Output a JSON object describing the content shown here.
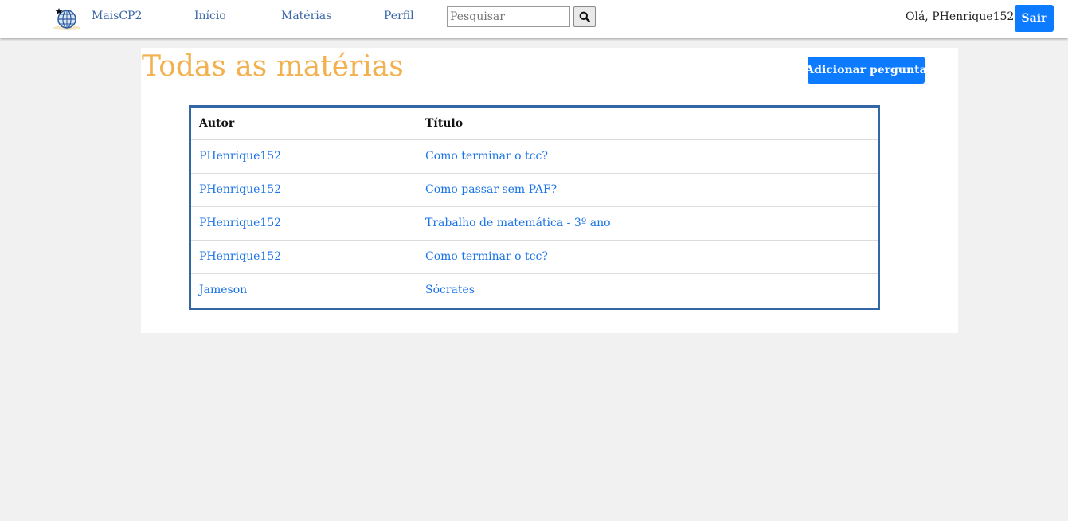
{
  "nav": {
    "brand": "MaisCP2",
    "links": [
      "Início",
      "Matérias",
      "Perfil"
    ],
    "search_placeholder": "Pesquisar",
    "greeting": "Olá, PHenrique152",
    "logout_label": "Sair"
  },
  "main": {
    "title": "Todas as matérias",
    "add_label": "Adicionar pergunta",
    "table": {
      "headers": [
        "Autor",
        "Título"
      ],
      "rows": [
        [
          "PHenrique152",
          "Como terminar o tcc?"
        ],
        [
          "PHenrique152",
          "Como passar sem PAF?"
        ],
        [
          "PHenrique152",
          "Trabalho de matemática - 3º ano"
        ],
        [
          "PHenrique152",
          "Como terminar o tcc?"
        ],
        [
          "Jameson",
          "Sócrates"
        ]
      ]
    }
  },
  "colors": {
    "accent": "#0d7bff",
    "title": "#f2b04e",
    "link": "#1a73e8",
    "table_border": "#3466a6"
  },
  "icons": {
    "logo": "globe-logo-icon",
    "search": "search-icon"
  }
}
